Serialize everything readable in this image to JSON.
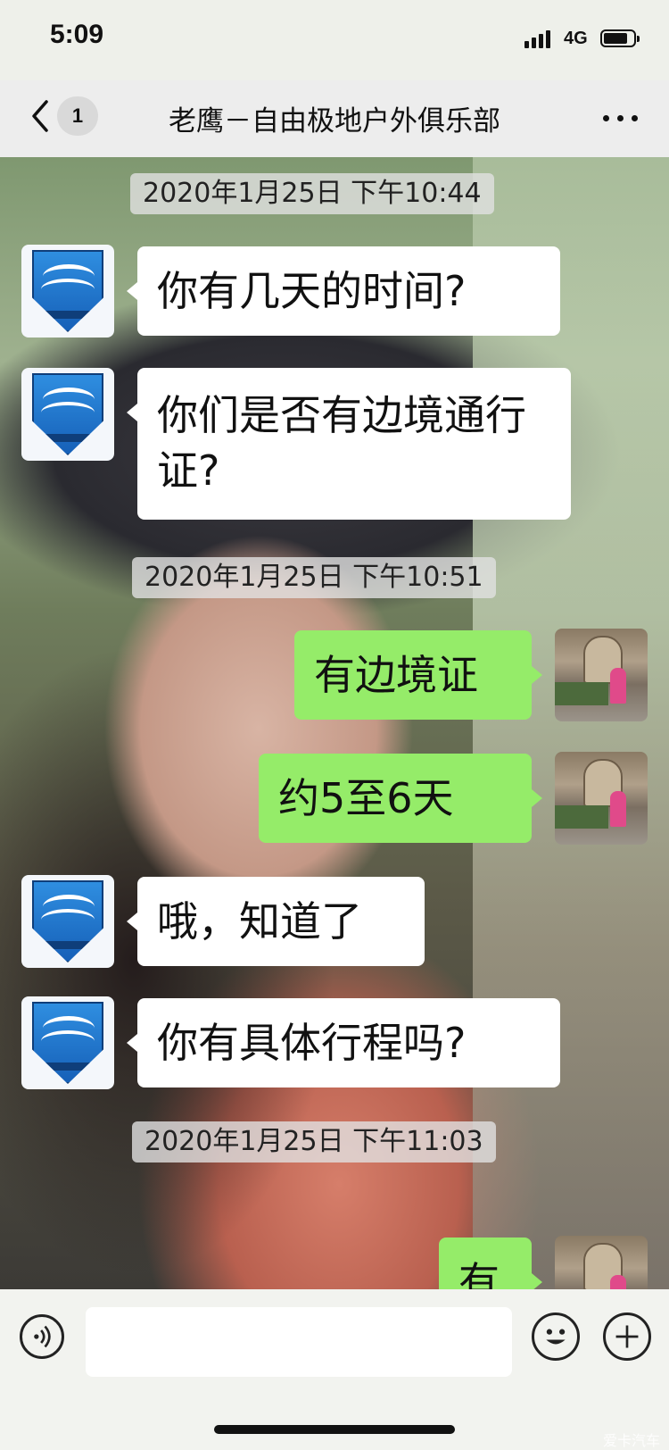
{
  "status": {
    "time": "5:09",
    "network": "4G"
  },
  "nav": {
    "unread_badge": "1",
    "title": "老鹰－自由极地户外俱乐部"
  },
  "chat": {
    "timestamps": [
      "2020年1月25日 下午10:44",
      "2020年1月25日 下午10:51",
      "2020年1月25日 下午11:03"
    ],
    "messages": [
      {
        "from": "other",
        "text": "你有几天的时间?"
      },
      {
        "from": "other",
        "text": "你们是否有边境通行证?"
      },
      {
        "from": "me",
        "text": "有边境证"
      },
      {
        "from": "me",
        "text": "约5至6天"
      },
      {
        "from": "other",
        "text": "哦，知道了"
      },
      {
        "from": "other",
        "text": "你有具体行程吗?"
      },
      {
        "from": "me",
        "text": "有"
      }
    ]
  },
  "input": {
    "placeholder": ""
  },
  "watermark": "爱卡汽车",
  "colors": {
    "outgoing_bubble": "#95ec69",
    "incoming_bubble": "#ffffff",
    "nav_bg": "#ededed"
  },
  "icons": [
    "back-chevron-icon",
    "more-icon",
    "voice-icon",
    "emoji-icon",
    "plus-icon",
    "signal-icon",
    "battery-icon"
  ]
}
